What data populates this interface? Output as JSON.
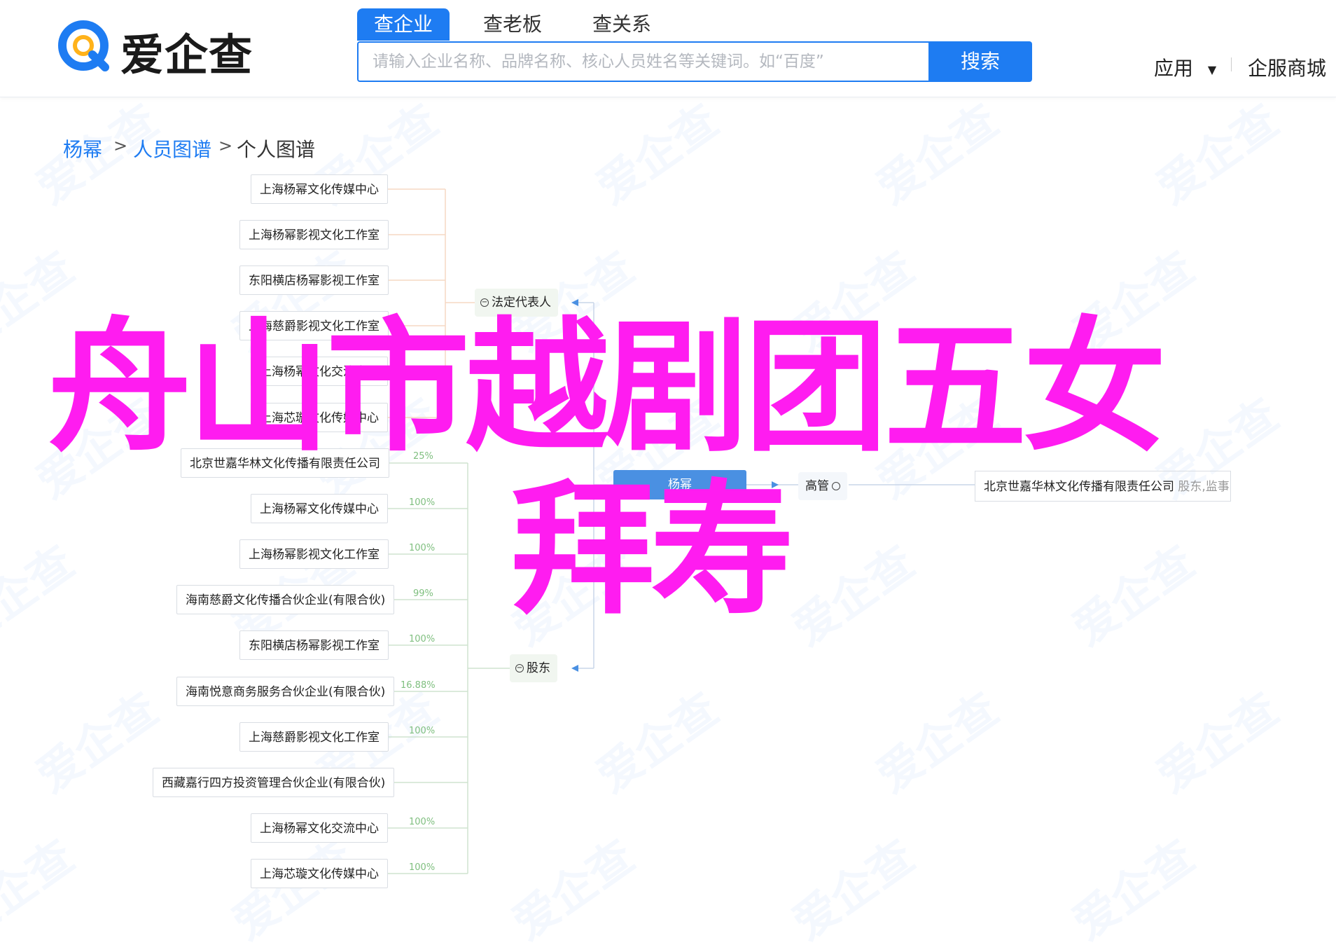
{
  "header": {
    "logo_text": "爱企查",
    "tabs": [
      {
        "label": "查企业",
        "active": true
      },
      {
        "label": "查老板",
        "active": false
      },
      {
        "label": "查关系",
        "active": false
      }
    ],
    "search_placeholder": "请输入企业名称、品牌名称、核心人员姓名等关键词。如“百度”",
    "search_button": "搜索",
    "nav_apps": "应用",
    "nav_mall": "企服商城"
  },
  "watermark_text": "爱企查",
  "breadcrumb": {
    "items": [
      "杨幂",
      "人员图谱",
      "个人图谱"
    ],
    "separator": ">"
  },
  "graph": {
    "person": "杨幂",
    "legal_rep_label": "法定代表人",
    "shareholder_label": "股东",
    "role_label": "高管",
    "executive_company": "北京世嘉华林文化传播有限责任公司",
    "executive_role": "股东,监事",
    "legal_rep_companies": [
      "上海杨幂文化传媒中心",
      "上海杨幂影视文化工作室",
      "东阳横店杨幂影视工作室",
      "上海慈爵影视文化工作室",
      "上海杨幂文化交流中心",
      "上海芯璇文化传媒中心"
    ],
    "shareholder_companies": [
      {
        "name": "北京世嘉华林文化传播有限责任公司",
        "pct": "25%"
      },
      {
        "name": "上海杨幂文化传媒中心",
        "pct": "100%"
      },
      {
        "name": "上海杨幂影视文化工作室",
        "pct": "100%"
      },
      {
        "name": "海南慈爵文化传播合伙企业(有限合伙)",
        "pct": "99%"
      },
      {
        "name": "东阳横店杨幂影视工作室",
        "pct": "100%"
      },
      {
        "name": "海南悦意商务服务合伙企业(有限合伙)",
        "pct": "16.88%"
      },
      {
        "name": "上海慈爵影视文化工作室",
        "pct": "100%"
      },
      {
        "name": "西藏嘉行四方投资管理合伙企业(有限合伙)",
        "pct": ""
      },
      {
        "name": "上海杨幂文化交流中心",
        "pct": "100%"
      },
      {
        "name": "上海芯璇文化传媒中心",
        "pct": "100%"
      }
    ]
  },
  "overlay": {
    "line1": "舟山市越剧团五女",
    "line2": "拜寿",
    "color": "#ff1cf0"
  },
  "colors": {
    "brand": "#1e7cf2",
    "person_node": "#4a90e2",
    "pct_text": "#7fbf7f"
  }
}
